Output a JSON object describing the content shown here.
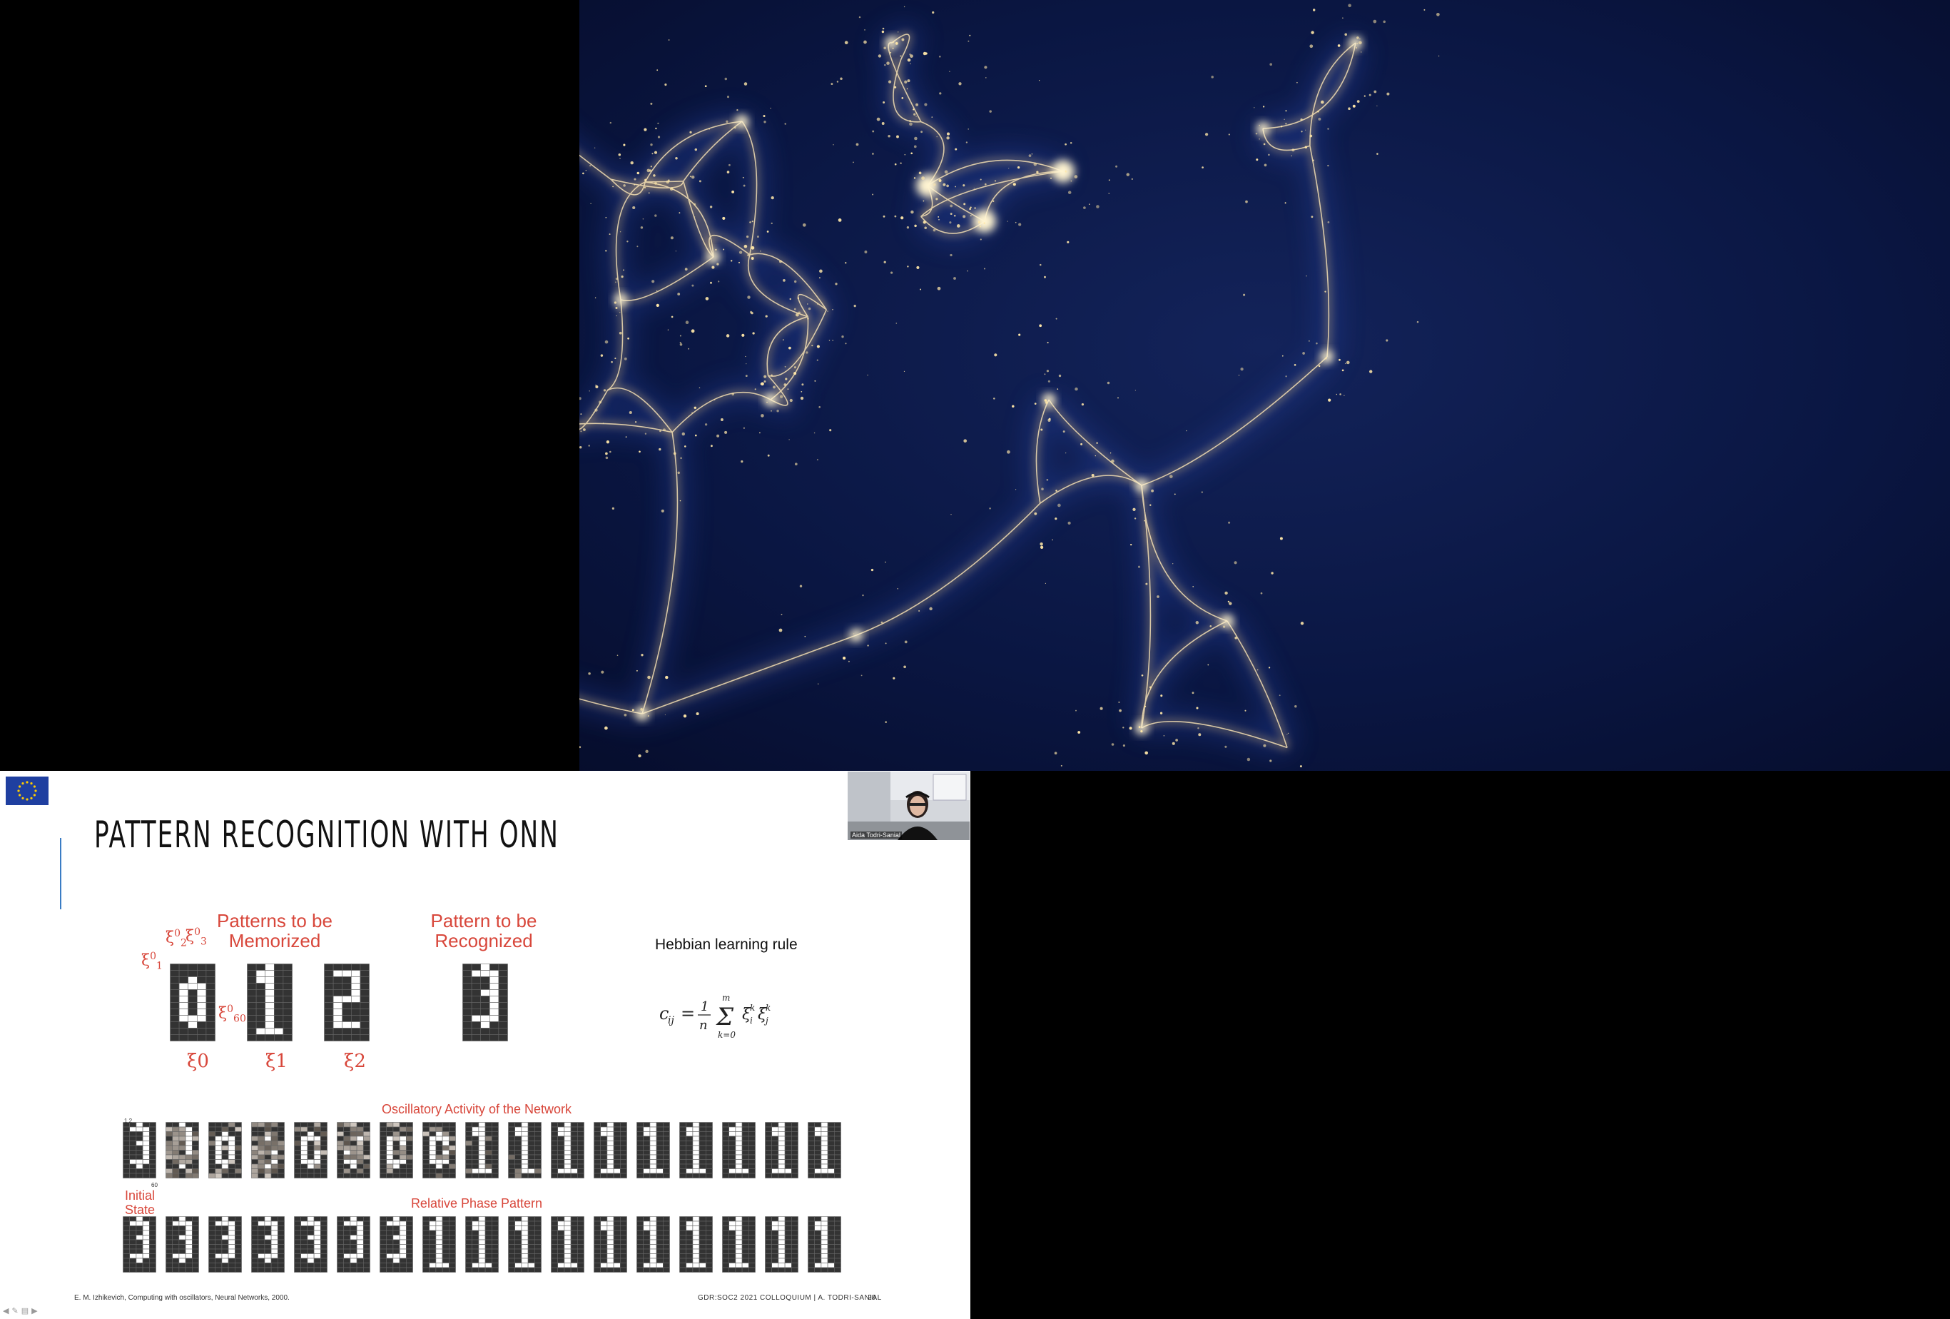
{
  "cosmic_image": {
    "label": "cosmic-web-simulation"
  },
  "slide": {
    "title": "PATTERN RECOGNITION WITH ONN",
    "patterns_memorized": [
      "Patterns to be",
      "Memorized"
    ],
    "pattern_recognized": [
      "Pattern to be",
      "Recognized"
    ],
    "xi_labels": [
      "ξ0",
      "ξ1",
      "ξ2"
    ],
    "xi_small": {
      "xi1": "ξ",
      "xi2": "ξ",
      "xi3": "ξ",
      "xi60": "ξ"
    },
    "hebbian_title": "Hebbian learning rule",
    "formula": "c_ij = (1/n) Σ_{k=0}^{m} ξ_i^k ξ_j^k",
    "oscillatory_label": "Oscillatory Activity of the Network",
    "initial_state": [
      "Initial",
      "State"
    ],
    "relative_phase_label": "Relative Phase Pattern",
    "reference": "E. M. Izhikevich, Computing with oscillators, Neural Networks, 2000.",
    "footer": "GDR:SOC2 2021 COLLOQUIUM | A. TODRI-SANIAL",
    "page_number": "20",
    "webcam_name": "Aida Todri-Sanial",
    "grid_number_labels": {
      "top_left": "1 2",
      "bottom_right": "60"
    }
  },
  "colors": {
    "accent": "#3a7cc4",
    "label_red": "#d8473b",
    "cell_dark": "#333333",
    "eu_blue": "#1f3fa0",
    "space_blue": "#0b1a4a",
    "galaxy_gold": "#ffd98a"
  }
}
